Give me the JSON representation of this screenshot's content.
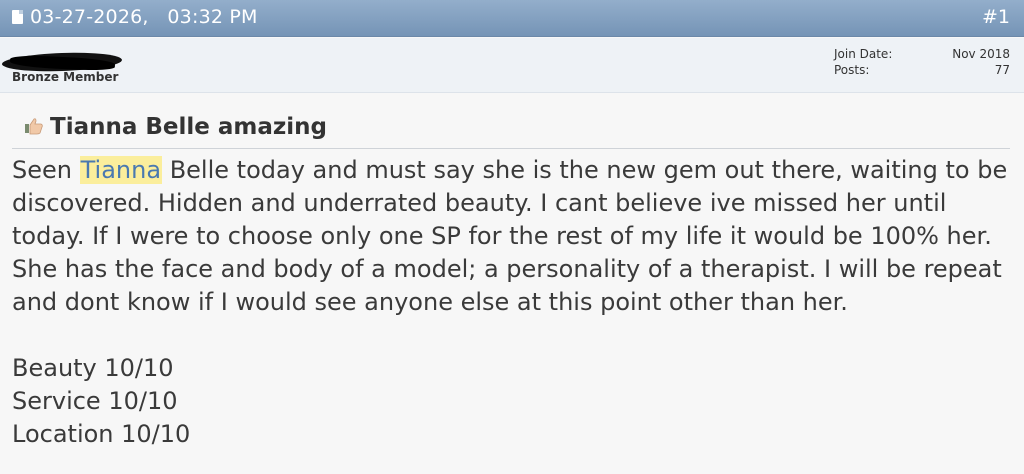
{
  "post": {
    "date": "03-27-2026,",
    "time": "03:32 PM",
    "number": "#1"
  },
  "user": {
    "title": "Bronze Member",
    "join_date_label": "Join Date:",
    "join_date": "Nov 2018",
    "posts_label": "Posts:",
    "posts": "77"
  },
  "thread": {
    "title": "Tianna Belle amazing"
  },
  "message": {
    "intro": "Seen",
    "highlight": "Tianna",
    "body": "Belle today and must say she is the new gem out there, waiting to be discovered. Hidden and underrated beauty. I cant believe ive missed her until today. If I were to choose only one SP for the rest of my life it would be 100% her. She has the face and body of a model; a personality of a therapist. I will be repeat and dont know if I would see anyone else at this point other than her.",
    "ratings": [
      "Beauty 10/10",
      "Service 10/10",
      "Location 10/10"
    ]
  },
  "colors": {
    "header": "#7f9dbf",
    "highlight": "#fbee9c",
    "highlight_text": "#4a79b0"
  },
  "icons": {
    "post": "document-icon",
    "title": "thumbs-up-icon"
  }
}
